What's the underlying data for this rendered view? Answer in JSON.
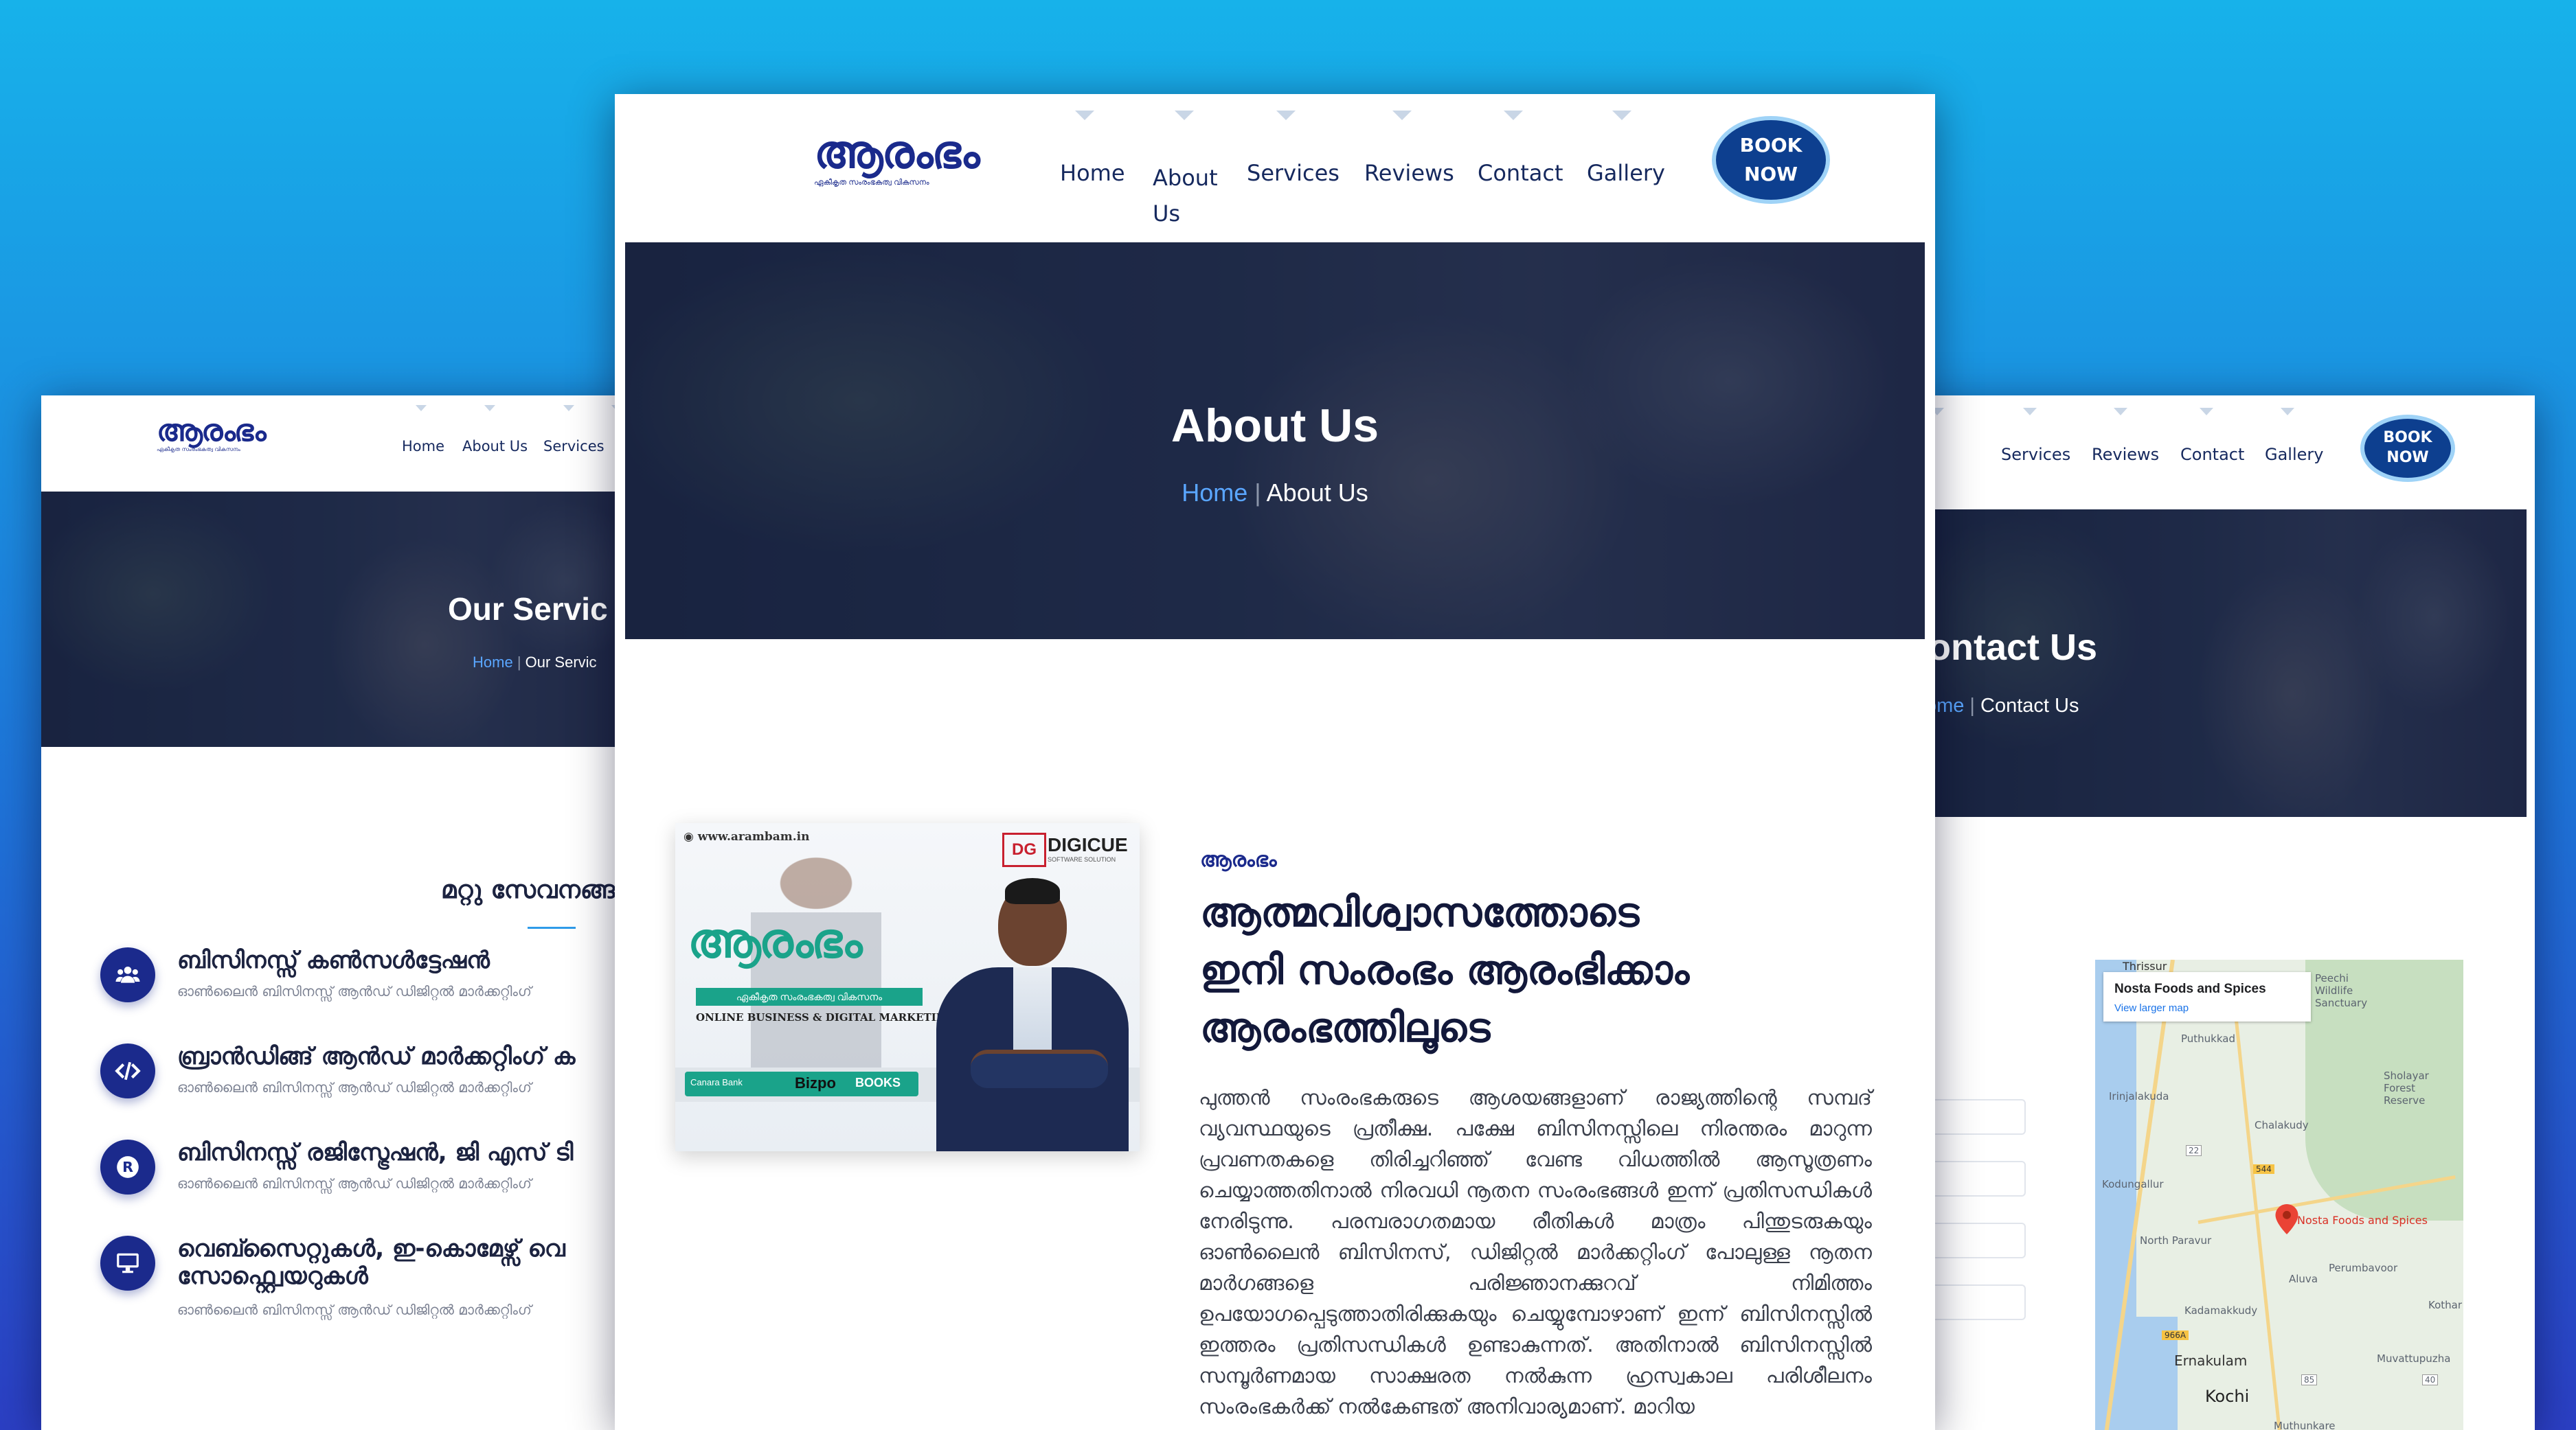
{
  "logo": {
    "mark": "ആരംഭം",
    "tagline": "ഏകീകൃത സംരംഭകത്വ വികസനം"
  },
  "nav": [
    "Home",
    "About Us",
    "Services",
    "Reviews",
    "Contact",
    "Gallery"
  ],
  "book_button": {
    "line1": "BOOK",
    "line2": "NOW"
  },
  "left_page": {
    "hero_title": "Our Servic",
    "crumb_home": "Home",
    "crumb_current": "Our Servic",
    "section_heading": "മറ്റു സേവനങ്ങ",
    "services": [
      {
        "title": "ബിസിനസ്സ് കൺസൾട്ടേഷൻ",
        "subtitle": "ഓൺലൈൻ ബിസിനസ്സ് ആൻഡ് ഡിജിറ്റൽ മാർക്കറ്റിംഗ്",
        "icon": "users-icon"
      },
      {
        "title": "ബ്രാൻഡിങ്ങ് ആൻഡ് മാർക്കറ്റിംഗ് ക",
        "subtitle": "ഓൺലൈൻ ബിസിനസ്സ് ആൻഡ് ഡിജിറ്റൽ മാർക്കറ്റിംഗ്",
        "icon": "code-icon"
      },
      {
        "title": "ബിസിനസ്സ് രജിസ്ട്രേഷൻ, ജി എസ് ടി",
        "subtitle": "ഓൺലൈൻ ബിസിനസ്സ് ആൻഡ് ഡിജിറ്റൽ മാർക്കറ്റിംഗ്",
        "icon": "registered-icon"
      },
      {
        "title": "വെബ്സൈറ്റുകൾ, ഇ-കൊമേഴ്സ് വെ",
        "title2": "സോഫ്റ്റ്വെയറുകൾ",
        "subtitle": "ഓൺലൈൻ ബിസിനസ്സ് ആൻഡ് ഡിജിറ്റൽ മാർക്കറ്റിംഗ്",
        "icon": "monitor-icon"
      }
    ]
  },
  "center_page": {
    "hero_title": "About Us",
    "crumb_home": "Home",
    "crumb_current": "About Us",
    "promo": {
      "website": "www.arambam.in",
      "brand": "DIGICUE",
      "brand_sub": "SOFTWARE SOLUTION",
      "mark": "ആരംഭം",
      "tagline": "ഏകീകൃത സംരംഭകത്വ വികസനം",
      "strap": "ONLINE BUSINESS & DIGITAL MARKETING",
      "partners": [
        "Canara Bank",
        "Bizpo",
        "BOOKS"
      ]
    },
    "eyebrow": "ആരംഭം",
    "heading_line1": "ആത്മവിശ്വാസത്തോടെ",
    "heading_line2": "ഇനി സംരംഭം ആരംഭിക്കാം",
    "heading_line3": "ആരംഭത്തിലൂടെ",
    "paragraph": "പുത്തൻ സംരംഭകരുടെ ആശയങ്ങളാണ് രാജ്യത്തിന്റെ സമ്പദ് വ്യവസ്ഥയുടെ പ്രതീക്ഷ. പക്ഷേ ബിസിനസ്സിലെ നിരന്തരം മാറുന്ന പ്രവണതകളെ തിരിച്ചറിഞ്ഞ് വേണ്ട വിധത്തിൽ ആസൂത്രണം ചെയ്യാത്തതിനാൽ നിരവധി നൂതന സംരംഭങ്ങൾ ഇന്ന് പ്രതിസന്ധികൾ നേരിടുന്നു. പരമ്പരാഗതമായ രീതികൾ മാത്രം പിന്തുടരുകയും ഓൺലൈൻ ബിസിനസ്, ഡിജിറ്റൽ മാർക്കറ്റിംഗ് പോലുള്ള നൂതന മാർഗങ്ങളെ പരിജ്ഞാനക്കുറവ് നിമിത്തം ഉപയോഗപ്പെടുത്താതിരിക്കുകയും ചെയ്യുമ്പോഴാണ് ഇന്ന് ബിസിനസ്സിൽ ഇത്തരം പ്രതിസന്ധികൾ ഉണ്ടാകുന്നത്. അതിനാൽ ബിസിനസ്സിൽ സമ്പൂർണമായ സാക്ഷരത നൽകുന്ന ഹ്രസ്വകാല പരിശീലനം സംരംഭകർക്ക് നൽകേണ്ടത് അനിവാര്യമാണ്. മാറിയ"
  },
  "right_page": {
    "hero_title": "Contact Us",
    "crumb_home": "Home",
    "crumb_current": "Contact Us",
    "map": {
      "place_name": "Nosta Foods and Spices",
      "view_larger": "View larger map",
      "pin_label": "Nosta Foods and Spices",
      "labels": [
        "Thrissur",
        "Peechi Wildlife Sanctuary",
        "Puthukkad",
        "Irinjalakuda",
        "Chalakudy",
        "Sholayar Forest Reserve",
        "Kodungallur",
        "North Paravur",
        "Aluva",
        "Perumbavoor",
        "Kadamakkudy",
        "Ernakulam",
        "Kochi",
        "Muvattupuzha",
        "Kothar",
        "Muthunkare"
      ],
      "road_numbers": [
        "22",
        "544",
        "966A",
        "85",
        "40"
      ]
    }
  },
  "colors": {
    "brand": "#1a2a8c",
    "button": "#0d3f8f",
    "link": "#5aa6ff",
    "background_top": "#17b2ea",
    "background_bottom": "#2b3fc4"
  }
}
